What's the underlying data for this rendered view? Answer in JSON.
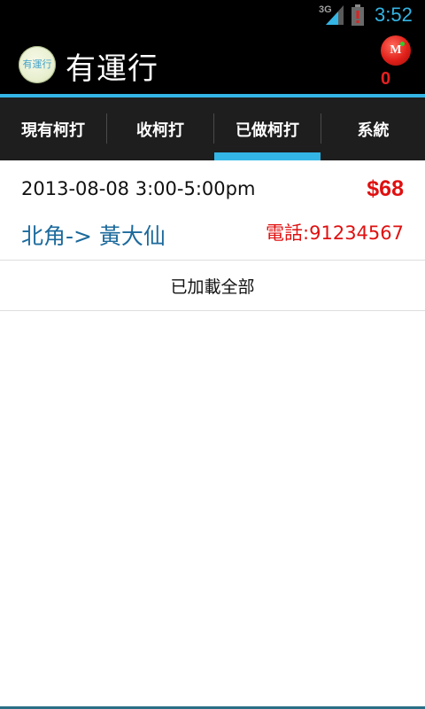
{
  "status_bar": {
    "network": "3G",
    "time": "3:52",
    "icons": [
      "signal-icon",
      "battery-alert-icon"
    ]
  },
  "action_bar": {
    "app_icon_label": "有運行",
    "title": "有運行",
    "badge_letter": "M",
    "badge_count": "0"
  },
  "tabs": [
    {
      "label": "現有柯打",
      "selected": false
    },
    {
      "label": "收柯打",
      "selected": false
    },
    {
      "label": "已做柯打",
      "selected": true
    },
    {
      "label": "系統",
      "selected": false
    }
  ],
  "orders": [
    {
      "datetime": "2013-08-08 3:00-5:00pm",
      "price": "$68",
      "route": "北角-> 黃大仙",
      "phone": "電話:91234567"
    }
  ],
  "list_footer": "已加載全部",
  "colors": {
    "accent": "#33b5e5",
    "price_red": "#e01010",
    "route_blue": "#1c6a9c",
    "tab_bg": "#1e1e1e"
  }
}
